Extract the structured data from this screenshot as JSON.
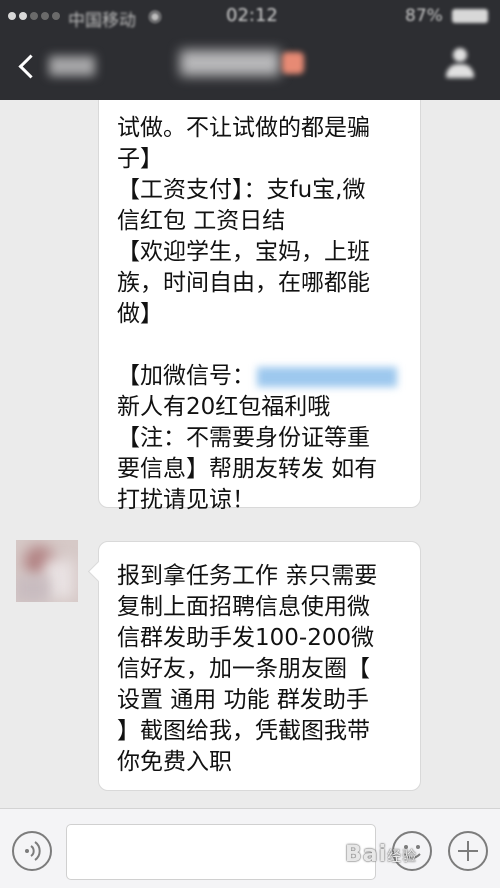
{
  "status_bar": {
    "signal": "●●○○○",
    "carrier": "中国移动",
    "time": "02:12",
    "battery": "87%"
  },
  "header": {
    "back_label": "",
    "chat_title": ""
  },
  "messages": [
    {
      "side": "received",
      "lines": [
        "试做。不让试做的都是骗",
        "子】",
        "【工资支付】：支fu宝,微",
        "信红包 工资日结",
        "【欢迎学生，宝妈，上班",
        "族，时间自由，在哪都能",
        "做】",
        "",
        "【加微信号：",
        "新人有20红包福利哦",
        "【注：不需要身份证等重",
        "要信息】帮朋友转发 如有",
        "打扰请见谅！"
      ]
    },
    {
      "side": "received",
      "lines": [
        "报到拿任务工作 亲只需要",
        "复制上面招聘信息使用微",
        "信群发助手发100-200微",
        "信好友，加一条朋友圈【",
        "设置  通用  功能  群发助手",
        "】截图给我，凭截图我带",
        "你免费入职"
      ]
    }
  ],
  "input_bar": {
    "placeholder": ""
  },
  "watermark": {
    "text": "Bai",
    "sub": "经验"
  },
  "colors": {
    "header_bg": "#2d2e32",
    "chat_bg": "#ebebeb",
    "bubble_bg": "#ffffff"
  },
  "icons": [
    "signal-icon",
    "wifi-icon",
    "battery-icon",
    "back-icon",
    "profile-icon",
    "voice-icon",
    "emoji-icon",
    "plus-icon"
  ]
}
